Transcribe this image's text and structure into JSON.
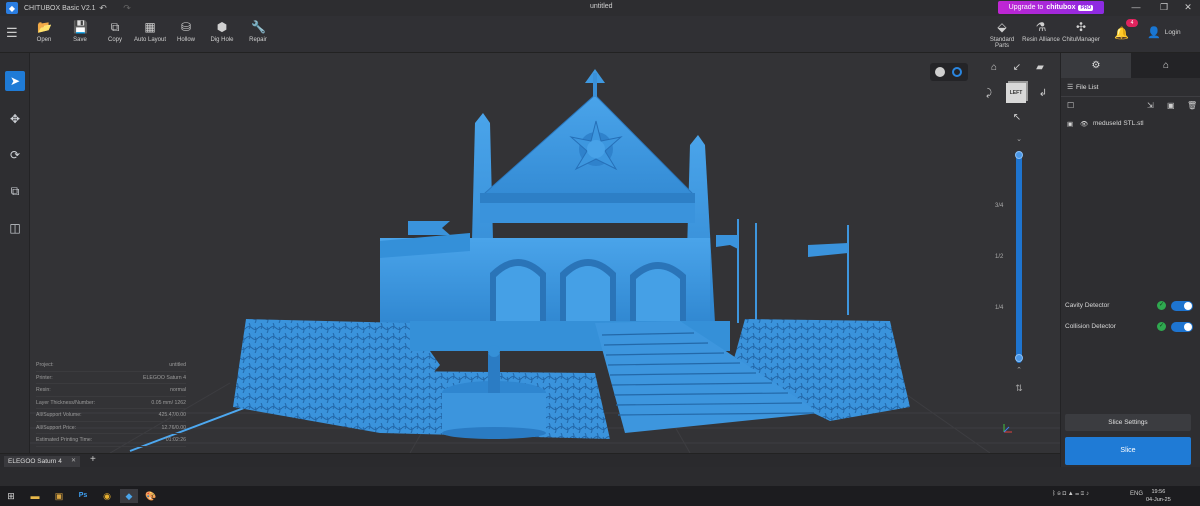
{
  "window": {
    "app_title": "CHITUBOX Basic V2.1",
    "doc_title": "untitled",
    "upgrade_label": "Upgrade to",
    "upgrade_brand": "chitubox",
    "upgrade_badge": "PRO"
  },
  "toolbar": {
    "tools": [
      {
        "label": "Open",
        "icon": "folder-open-icon",
        "glyph": "📂"
      },
      {
        "label": "Save",
        "icon": "save-icon",
        "glyph": "💾"
      },
      {
        "label": "Copy",
        "icon": "copy-icon",
        "glyph": "⧉"
      },
      {
        "label": "Auto Layout",
        "icon": "auto-layout-icon",
        "glyph": "▦"
      },
      {
        "label": "Hollow",
        "icon": "hollow-icon",
        "glyph": "⛁"
      },
      {
        "label": "Dig Hole",
        "icon": "dig-hole-icon",
        "glyph": "⬢"
      },
      {
        "label": "Repair",
        "icon": "repair-icon",
        "glyph": "🔧"
      }
    ],
    "right_tools": [
      {
        "label": "Standard Parts",
        "icon": "standard-parts-icon",
        "glyph": "⬙"
      },
      {
        "label": "Resin Alliance",
        "icon": "resin-alliance-icon",
        "glyph": "⚗"
      },
      {
        "label": "ChituManager",
        "icon": "chitumanager-icon",
        "glyph": "✣"
      }
    ],
    "notification_count": "4",
    "login_label": "Login"
  },
  "info": {
    "rows": [
      {
        "label": "Project:",
        "value": "untitled"
      },
      {
        "label": "Printer:",
        "value": "ELEGOO Saturn 4"
      },
      {
        "label": "Resin:",
        "value": "normal"
      },
      {
        "label": "Layer Thickness/Number:",
        "value": "0.05 mm/ 1262"
      },
      {
        "label": "All/Support Volume:",
        "value": "425.47/0.00"
      },
      {
        "label": "All/Support Price:",
        "value": "12.76/0.00"
      },
      {
        "label": "Estimated Printing Time:",
        "value": "01:02:26"
      }
    ]
  },
  "view": {
    "cube_face": "LEFT",
    "slider_labels": [
      "3/4",
      "1/2",
      "1/4"
    ]
  },
  "right_panel": {
    "file_list_title": "File List",
    "files": [
      "meduseId STL.stl"
    ],
    "cavity_detector": "Cavity Detector",
    "collision_detector": "Collision Detector",
    "slice_settings": "Slice Settings",
    "slice": "Slice"
  },
  "bottom": {
    "printer_tab": "ELEGOO Saturn 4"
  },
  "taskbar": {
    "lang": "ENG",
    "time": "19:56",
    "date": "04-Jun-25"
  },
  "colors": {
    "accent": "#1f7bd6",
    "model": "#3b96df",
    "upgrade_gradient_start": "#c026d3"
  }
}
